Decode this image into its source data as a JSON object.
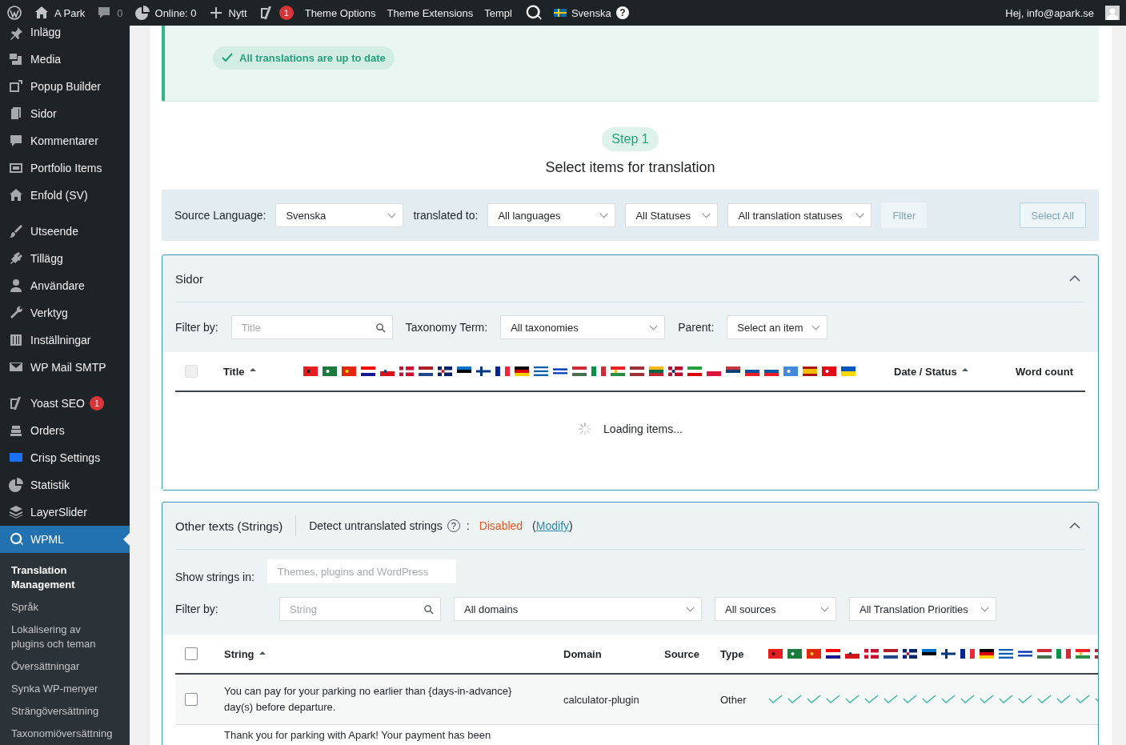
{
  "admin_bar": {
    "site": "A Park",
    "comments": "0",
    "online": "Online: 0",
    "new": "Nytt",
    "seo_badge": "1",
    "links": [
      "Theme Options",
      "Theme Extensions",
      "Templ"
    ],
    "language": "Svenska",
    "help": "?",
    "greeting": "Hej, info@apark.se"
  },
  "sidebar": {
    "groups": [
      [
        {
          "label": "Inlägg",
          "selected": false
        },
        {
          "label": "Media",
          "selected": false
        },
        {
          "label": "Popup Builder",
          "selected": false
        },
        {
          "label": "Sidor",
          "selected": false
        },
        {
          "label": "Kommentarer",
          "selected": false
        },
        {
          "label": "Portfolio Items",
          "selected": false
        },
        {
          "label": "Enfold (SV)",
          "selected": false
        }
      ],
      [
        {
          "label": "Utseende",
          "selected": false
        },
        {
          "label": "Tillägg",
          "selected": false
        },
        {
          "label": "Användare",
          "selected": false
        },
        {
          "label": "Verktyg",
          "selected": false
        },
        {
          "label": "Inställningar",
          "selected": false
        },
        {
          "label": "WP Mail SMTP",
          "selected": false
        }
      ],
      [
        {
          "label": "Yoast SEO",
          "selected": false,
          "badge": "1"
        },
        {
          "label": "Orders",
          "selected": false
        },
        {
          "label": "Crisp Settings",
          "selected": false
        },
        {
          "label": "Statistik",
          "selected": false
        },
        {
          "label": "LayerSlider",
          "selected": false
        },
        {
          "label": "WPML",
          "selected": true
        }
      ]
    ],
    "submenu": [
      {
        "label": "Translation Management",
        "selected": true
      },
      {
        "label": "Språk",
        "selected": false
      },
      {
        "label": "Lokalisering av plugins och teman",
        "selected": false
      },
      {
        "label": "Översättningar",
        "selected": false
      },
      {
        "label": "Synka WP-menyer",
        "selected": false
      },
      {
        "label": "Strängöversättning",
        "selected": false
      },
      {
        "label": "Taxonomiöversättning",
        "selected": false
      }
    ]
  },
  "notice": {
    "badge": "All translations are up to date"
  },
  "step": {
    "label": "Step 1",
    "title": "Select items for translation"
  },
  "filter_bar": {
    "source_label": "Source Language:",
    "source": "Svenska",
    "target_label": "translated to:",
    "target": "All languages",
    "statuses": "All Statuses",
    "translation_statuses": "All translation statuses",
    "filter_button": {
      "label": "Filter",
      "disabled": true
    },
    "select_all": {
      "label": "Select All",
      "disabled": true
    }
  },
  "posts_panel": {
    "title": "Sidor",
    "expanded": true,
    "filter_label": "Filter by:",
    "title_placeholder": "Title",
    "taxonomy_label": "Taxonomy Term:",
    "taxonomy": "All taxonomies",
    "parent_label": "Parent:",
    "parent": "Select an item",
    "columns": {
      "title": "Title",
      "date": "Date / Status",
      "words": "Word count"
    },
    "select_all": {
      "checked": false,
      "disabled": true
    },
    "loading": "Loading items..."
  },
  "strings_panel": {
    "title": "Other texts (Strings)",
    "expanded": true,
    "detect_label": "Detect untranslated strings",
    "help": "?",
    "colon": ":",
    "status": "Disabled",
    "modify_open": "(",
    "modify": "Modify",
    "modify_close": ")",
    "show_label": "Show strings in:",
    "show_value": "Themes, plugins and WordPress",
    "filter_label": "Filter by:",
    "string_placeholder": "String",
    "domain": "All domains",
    "source": "All sources",
    "priority": "All Translation Priorities",
    "columns": {
      "string": "String",
      "domain": "Domain",
      "source": "Source",
      "type": "Type"
    },
    "select_all": {
      "checked": false
    },
    "rows": [
      {
        "string": "You can pay for your parking no earlier than {days-in-advance} day(s) before departure.",
        "domain": "calculator-plugin",
        "type": "Other",
        "checked": false,
        "translated": true
      },
      {
        "string": "Thank you for parking with Apark! Your payment has been"
      }
    ]
  }
}
